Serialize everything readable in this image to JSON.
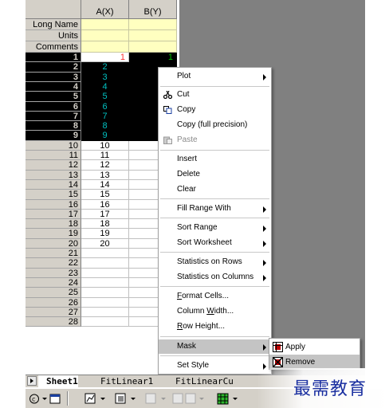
{
  "sheet": {
    "columns": [
      "A(X)",
      "B(Y)"
    ],
    "meta_rows": [
      "Long Name",
      "Units",
      "Comments"
    ],
    "rows": [
      {
        "n": "1",
        "a": "1",
        "b": "1"
      },
      {
        "n": "2",
        "a": "2",
        "b": ""
      },
      {
        "n": "3",
        "a": "3",
        "b": ""
      },
      {
        "n": "4",
        "a": "4",
        "b": ""
      },
      {
        "n": "5",
        "a": "5",
        "b": ""
      },
      {
        "n": "6",
        "a": "6",
        "b": ""
      },
      {
        "n": "7",
        "a": "7",
        "b": ""
      },
      {
        "n": "8",
        "a": "8",
        "b": ""
      },
      {
        "n": "9",
        "a": "9",
        "b": ""
      },
      {
        "n": "10",
        "a": "10",
        "b": ""
      },
      {
        "n": "11",
        "a": "11",
        "b": ""
      },
      {
        "n": "12",
        "a": "12",
        "b": ""
      },
      {
        "n": "13",
        "a": "13",
        "b": ""
      },
      {
        "n": "14",
        "a": "14",
        "b": ""
      },
      {
        "n": "15",
        "a": "15",
        "b": ""
      },
      {
        "n": "16",
        "a": "16",
        "b": ""
      },
      {
        "n": "17",
        "a": "17",
        "b": ""
      },
      {
        "n": "18",
        "a": "18",
        "b": ""
      },
      {
        "n": "19",
        "a": "19",
        "b": ""
      },
      {
        "n": "20",
        "a": "20",
        "b": ""
      },
      {
        "n": "21",
        "a": "",
        "b": ""
      },
      {
        "n": "22",
        "a": "",
        "b": ""
      },
      {
        "n": "23",
        "a": "",
        "b": ""
      },
      {
        "n": "24",
        "a": "",
        "b": ""
      },
      {
        "n": "25",
        "a": "",
        "b": ""
      },
      {
        "n": "26",
        "a": "",
        "b": ""
      },
      {
        "n": "27",
        "a": "",
        "b": ""
      },
      {
        "n": "28",
        "a": "",
        "b": ""
      }
    ]
  },
  "context_menu": {
    "plot": "Plot",
    "cut": "Cut",
    "copy": "Copy",
    "copy_full": "Copy (full precision)",
    "paste": "Paste",
    "insert": "Insert",
    "delete": "Delete",
    "clear": "Clear",
    "fill_range_with": "Fill Range With",
    "sort_range": "Sort Range",
    "sort_worksheet": "Sort Worksheet",
    "stats_rows": "Statistics on Rows",
    "stats_columns": "Statistics on Columns",
    "format_cells": "Format Cells...",
    "column_width": "Column Width...",
    "row_height": "Row Height...",
    "mask": "Mask",
    "set_style": "Set Style"
  },
  "mask_submenu": {
    "apply": "Apply",
    "remove": "Remove"
  },
  "tabs": [
    "Sheet1",
    "FitLinear1",
    "FitLinearCu"
  ],
  "watermark": "最需教育",
  "colors": {
    "header_gray": "#d4d0c8",
    "meta_yellow": "#ffffc0",
    "selection": "#000000",
    "selected_text": "#00c0c0",
    "menu_highlight": "#c4c4c4",
    "watermark_blue": "#1a2fa0"
  }
}
